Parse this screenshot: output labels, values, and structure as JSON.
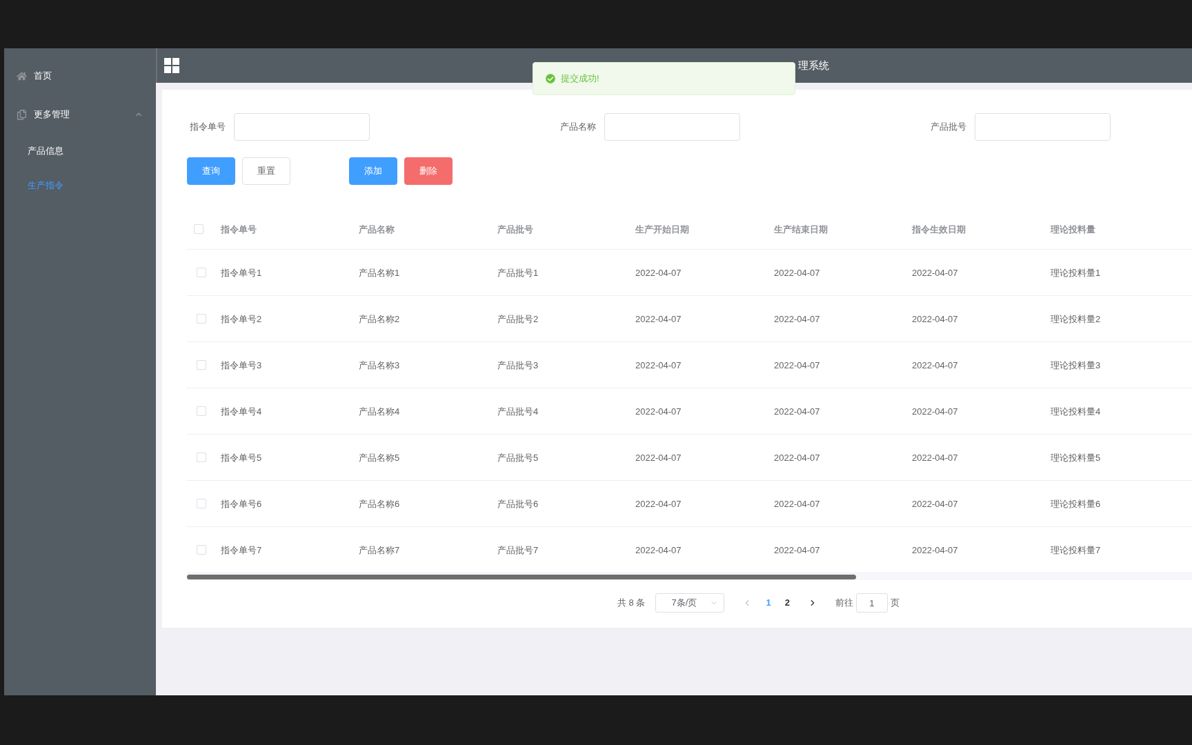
{
  "sidebar": {
    "items": [
      {
        "label": "首页",
        "selected": false
      },
      {
        "label": "更多管理",
        "expanded": true,
        "selected": false,
        "children": [
          {
            "label": "产品信息",
            "selected": false
          },
          {
            "label": "生产指令",
            "selected": true
          }
        ]
      }
    ]
  },
  "header": {
    "title": "理系统"
  },
  "toast": {
    "message": "提交成功!"
  },
  "search": {
    "fields": [
      {
        "label": "指令单号"
      },
      {
        "label": "产品名称"
      },
      {
        "label": "产品批号"
      }
    ]
  },
  "buttons": [
    {
      "label": "查询",
      "kind": "primary"
    },
    {
      "label": "重置",
      "kind": "default"
    },
    {
      "label": "添加",
      "kind": "primary"
    },
    {
      "label": "删除",
      "kind": "danger"
    }
  ],
  "table": {
    "select_all_checked": false,
    "columns": [
      "指令单号",
      "产品名称",
      "产品批号",
      "生产开始日期",
      "生产结束日期",
      "指令生效日期",
      "理论投料量"
    ],
    "rows": [
      {
        "checked": false,
        "cells": [
          "指令单号1",
          "产品名称1",
          "产品批号1",
          "2022-04-07",
          "2022-04-07",
          "2022-04-07",
          "理论投料量1"
        ]
      },
      {
        "checked": false,
        "cells": [
          "指令单号2",
          "产品名称2",
          "产品批号2",
          "2022-04-07",
          "2022-04-07",
          "2022-04-07",
          "理论投料量2"
        ]
      },
      {
        "checked": false,
        "cells": [
          "指令单号3",
          "产品名称3",
          "产品批号3",
          "2022-04-07",
          "2022-04-07",
          "2022-04-07",
          "理论投料量3"
        ]
      },
      {
        "checked": false,
        "cells": [
          "指令单号4",
          "产品名称4",
          "产品批号4",
          "2022-04-07",
          "2022-04-07",
          "2022-04-07",
          "理论投料量4"
        ]
      },
      {
        "checked": false,
        "cells": [
          "指令单号5",
          "产品名称5",
          "产品批号5",
          "2022-04-07",
          "2022-04-07",
          "2022-04-07",
          "理论投料量5"
        ]
      },
      {
        "checked": false,
        "cells": [
          "指令单号6",
          "产品名称6",
          "产品批号6",
          "2022-04-07",
          "2022-04-07",
          "2022-04-07",
          "理论投料量6"
        ]
      },
      {
        "checked": false,
        "cells": [
          "指令单号7",
          "产品名称7",
          "产品批号7",
          "2022-04-07",
          "2022-04-07",
          "2022-04-07",
          "理论投料量7"
        ]
      }
    ]
  },
  "pagination": {
    "total": "共 8 条",
    "page_size": "7条/页",
    "pages": [
      {
        "label": "1",
        "selected": true
      },
      {
        "label": "2",
        "selected": false
      }
    ],
    "goto_label": "前往",
    "goto_value": "1",
    "goto_suffix": "页"
  }
}
